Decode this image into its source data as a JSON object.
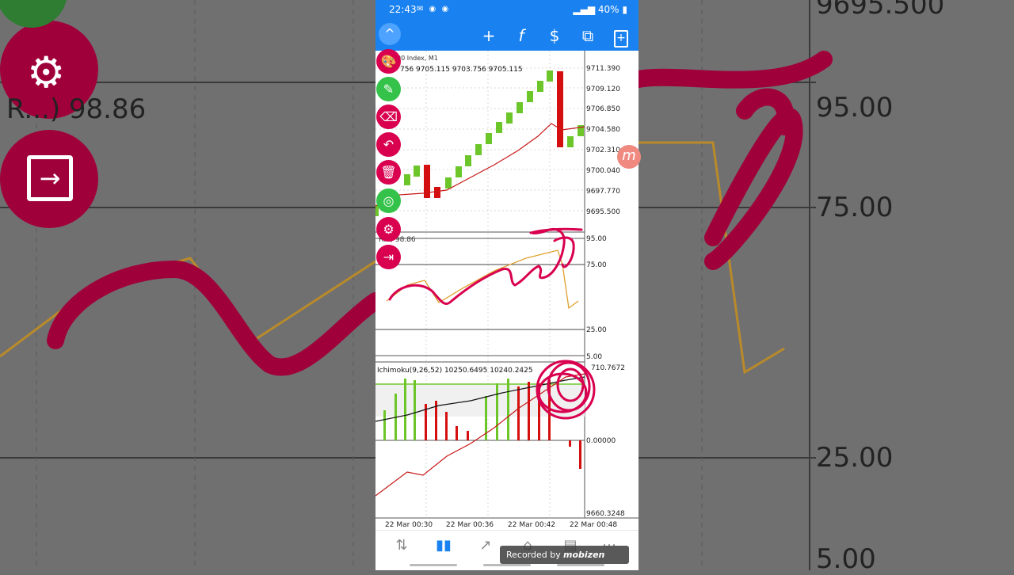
{
  "status": {
    "time": "22:43",
    "battery": "40%"
  },
  "toolbar": {
    "up": "^",
    "crosshair": "+",
    "indicators": "f",
    "symbols": "$",
    "windows": "⧉",
    "new_order": "+"
  },
  "chart_main": {
    "title": "00 Index, M1",
    "ohlc": "756 9705.115 9703.756 9705.115",
    "price_labels": [
      "9711.390",
      "9709.120",
      "9706.850",
      "9704.580",
      "9702.310",
      "9700.040",
      "9697.770",
      "9695.500"
    ]
  },
  "chart_rsi": {
    "title": "R...) 98.86",
    "levels": [
      "95.00",
      "75.00",
      "25.00",
      "5.00"
    ]
  },
  "chart_ichimoku": {
    "title": "Ichimoku(9,26,52) 10250.6495 10240.2425",
    "top_value": "710.7672",
    "zero_label": "0.00000",
    "bottom_value": "9660.3248"
  },
  "time_axis": [
    "22 Mar 00:30",
    "22 Mar 00:36",
    "22 Mar 00:42",
    "22 Mar 00:48"
  ],
  "background_labels": {
    "top_right": "9695.500",
    "rsi_value": "R...) 98.86",
    "level_95": "95.00",
    "level_75": "75.00",
    "level_25": "25.00",
    "level_5": "5.00"
  },
  "recorder": {
    "label": "Recorded by",
    "brand": "mobizen"
  },
  "colors": {
    "accent": "#1a82f0",
    "bull": "#6cc62a",
    "bear": "#d40f0f",
    "drawing": "#d8004f",
    "rsi_line": "#e0a030"
  },
  "icons": {
    "side_buttons": [
      "palette-icon",
      "brush-icon",
      "eraser-icon",
      "undo-icon",
      "trash-icon",
      "hide-icon",
      "gear-icon",
      "exit-icon"
    ],
    "bottom_nav": [
      "quotes-icon",
      "chart-icon",
      "trade-icon",
      "history-icon",
      "news-icon",
      "more-icon"
    ]
  }
}
